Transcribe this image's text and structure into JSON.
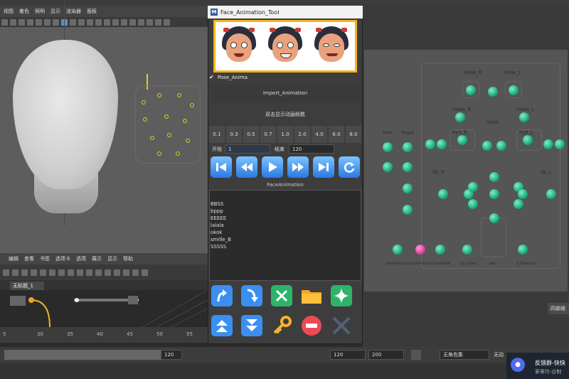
{
  "maya": {
    "menu": [
      "视图",
      "着色",
      "照明",
      "显示",
      "渲染器",
      "面板"
    ],
    "graph_menu": [
      "编辑",
      "查看",
      "书签",
      "选项卡",
      "选项",
      "展示",
      "显示",
      "帮助"
    ],
    "graph_tab": "无标题_1",
    "timeline_ticks": [
      "5",
      "30",
      "35",
      "40",
      "45",
      "50",
      "55"
    ],
    "range": {
      "current": "120",
      "start": "120",
      "end": "200",
      "anim_set": "无角色集",
      "no_anim": "无动"
    }
  },
  "tool": {
    "title": "Face_Animation_Tool",
    "pose_label": "Pose_Anima",
    "pose_checked": true,
    "import_label": "import_Animation",
    "frames_label": "双击显示动画帧数",
    "speeds": [
      "0.1",
      "0.3",
      "0.5",
      "0.7",
      "1.0",
      "2.0",
      "4.0",
      "6.0",
      "8.0"
    ],
    "start_label": "开始",
    "start_value": "1",
    "end_label": "结束",
    "end_value": "120",
    "face_animation_label": "FaceAnimation",
    "animations": [
      "BBSS",
      "bppp",
      "EEEEE",
      "lalala",
      "okok",
      "smille_B",
      "SSSSS"
    ]
  },
  "picker": {
    "labels": {
      "brow_r": "brow_R",
      "brow_l": "brow_L",
      "close_r": "close_R",
      "close_l": "close_L",
      "nose": "nose",
      "eye_r": "eye_R",
      "eye_l": "eye_L",
      "teeth": "Teeth",
      "tongue": "Tongue",
      "lip_r": "lip_R",
      "lip_l": "lip_L",
      "jaw": "jaw",
      "mouth_pucker": "mouthPucker",
      "mouth_funnel": "mouthFunnel",
      "cheek_puff": "CheekPuff",
      "lip_close": "lip_Close",
      "jaw_forward": "jf_Forward"
    },
    "button": "四部维"
  },
  "notification": {
    "title": "反馈群-快快",
    "subtitle": "萝蒂玲:@制"
  }
}
